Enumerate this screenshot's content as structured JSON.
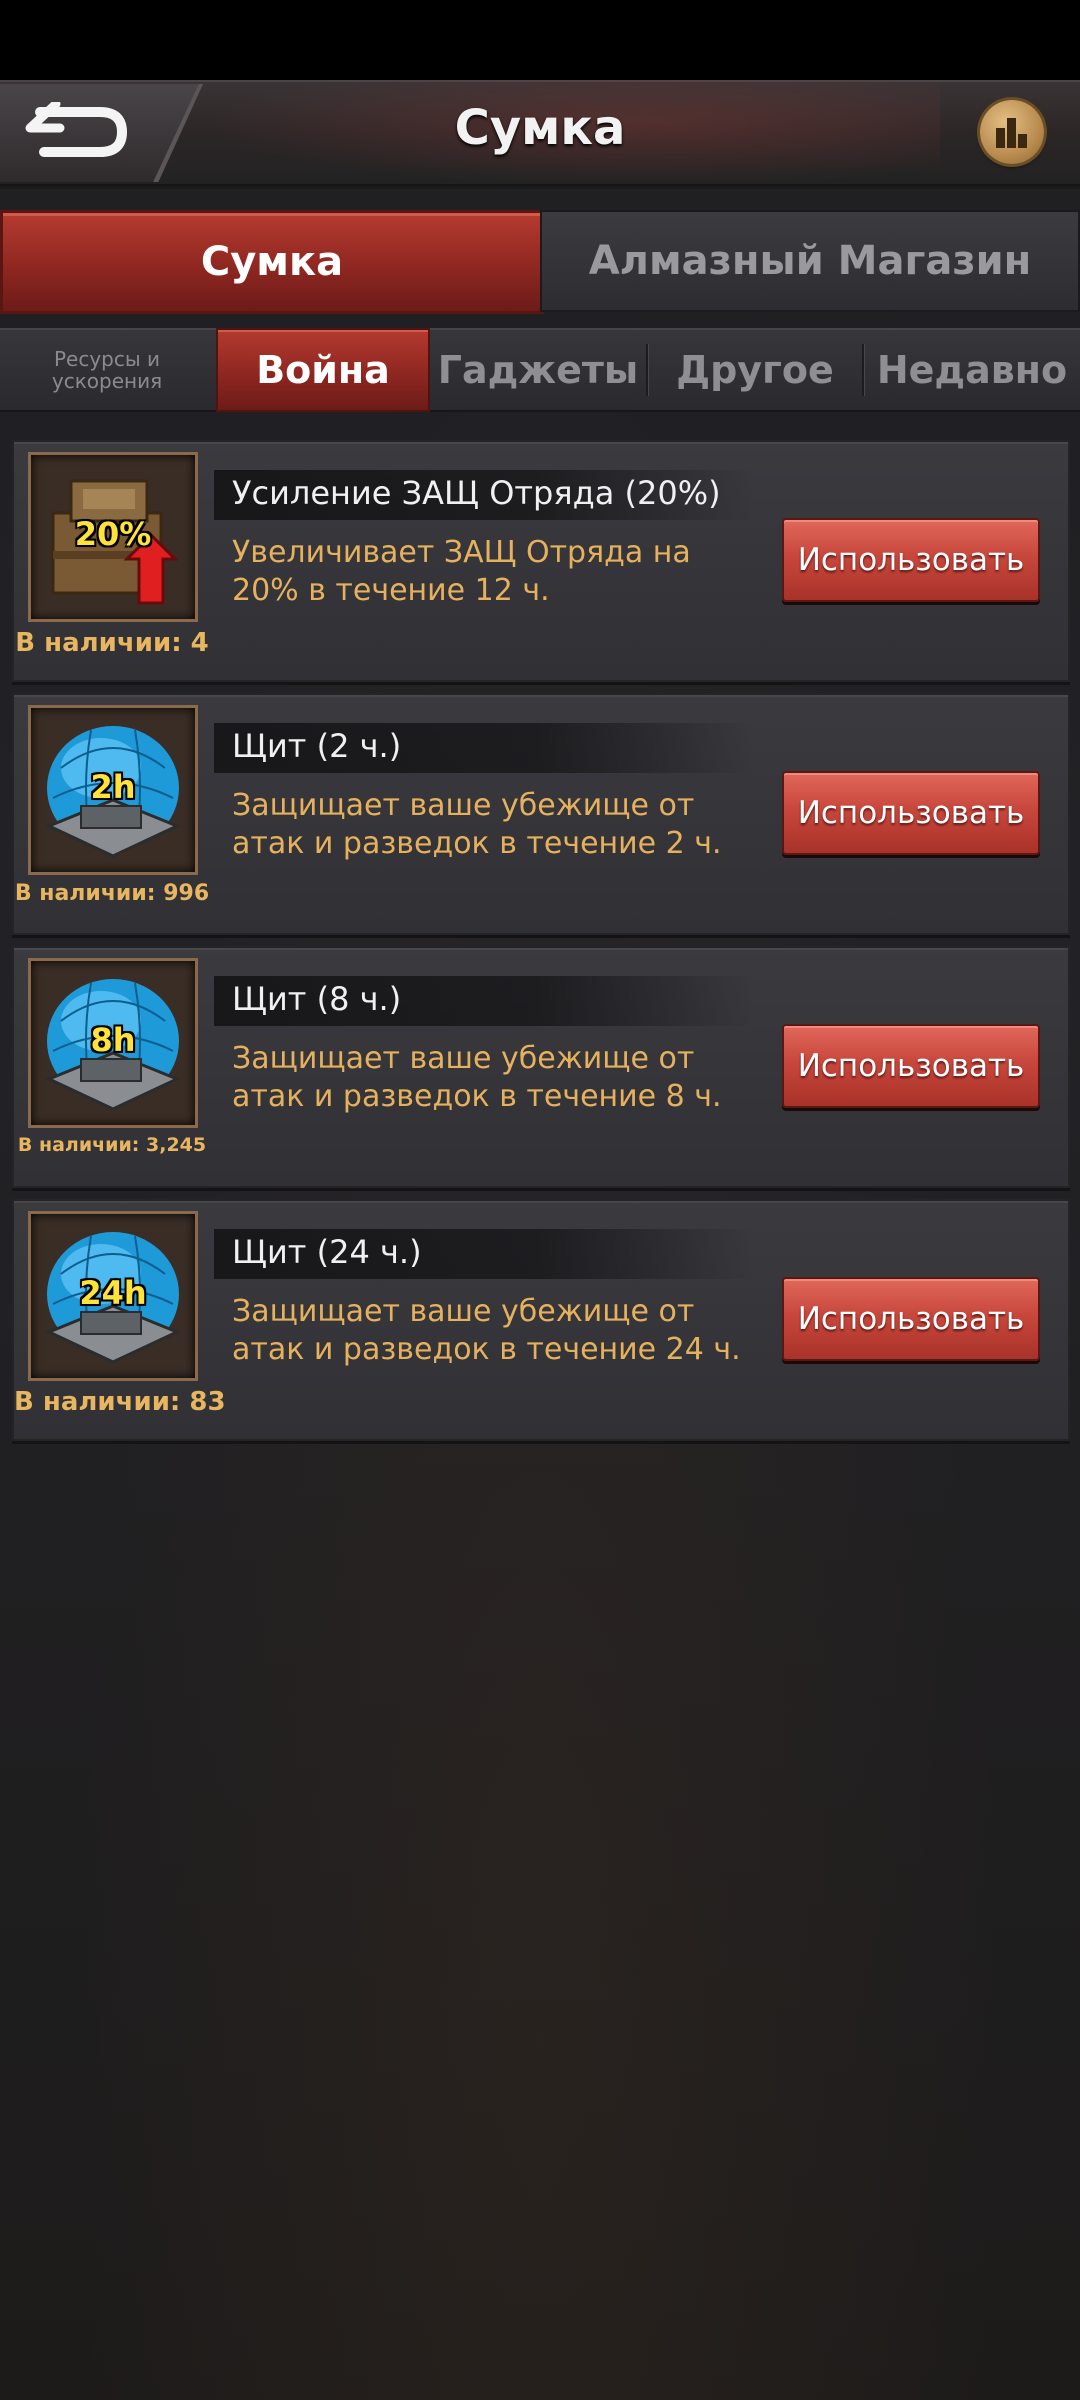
{
  "header": {
    "title": "Сумка"
  },
  "main_tabs": [
    {
      "label": "Сумка",
      "active": true
    },
    {
      "label": "Алмазный Магазин",
      "active": false
    }
  ],
  "sub_tabs": [
    {
      "label_line1": "Ресурсы и",
      "label_line2": "ускорения",
      "active": false
    },
    {
      "label": "Война",
      "active": true
    },
    {
      "label": "Гаджеты",
      "active": false
    },
    {
      "label": "Другое",
      "active": false
    },
    {
      "label": "Недавно",
      "active": false
    }
  ],
  "items": [
    {
      "name": "Усиление ЗАЩ Отряда (20%)",
      "description": "Увеличивает ЗАЩ Отряда на 20% в течение 12 ч.",
      "icon_label": "20%",
      "icon": "defense-boost-crate-icon",
      "stock": "В наличии: 4",
      "button": "Использовать"
    },
    {
      "name": "Щит (2 ч.)",
      "description": "Защищает ваше убежище от атак и разведок в течение 2 ч.",
      "icon_label": "2h",
      "icon": "shield-dome-icon",
      "stock": "В наличии: 996",
      "button": "Использовать"
    },
    {
      "name": "Щит (8 ч.)",
      "description": "Защищает ваше убежище от атак и разведок в течение 8 ч.",
      "icon_label": "8h",
      "icon": "shield-dome-icon",
      "stock": "В наличии: 3,245",
      "button": "Использовать"
    },
    {
      "name": "Щит (24 ч.)",
      "description": "Защищает ваше убежище от атак и разведок в течение 24 ч.",
      "icon_label": "24h",
      "icon": "shield-dome-icon",
      "stock": "В наличии: 83",
      "button": "Использовать"
    }
  ],
  "colors": {
    "accent_red": "#b53b30",
    "description_gold": "#e6b15e",
    "icon_label_yellow": "#ffe33a"
  }
}
